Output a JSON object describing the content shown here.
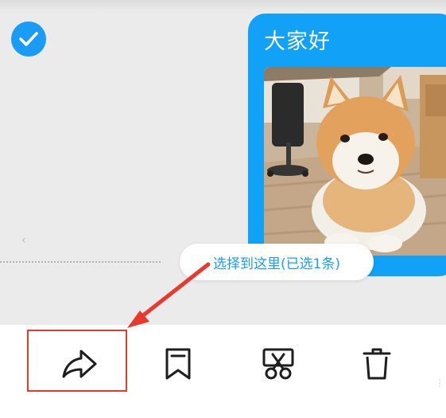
{
  "message": {
    "text": "大家好",
    "image_alt": "柴犬"
  },
  "selection": {
    "pill_label": "选择到这里(已选1条)"
  },
  "toolbar": {
    "items": [
      {
        "icon": "forward-icon"
      },
      {
        "icon": "bookmark-icon"
      },
      {
        "icon": "scissors-icon"
      },
      {
        "icon": "trash-icon"
      }
    ]
  },
  "colors": {
    "accent": "#1a9bf5",
    "bubble": "#11a1f7",
    "annotation": "#e8392e"
  }
}
